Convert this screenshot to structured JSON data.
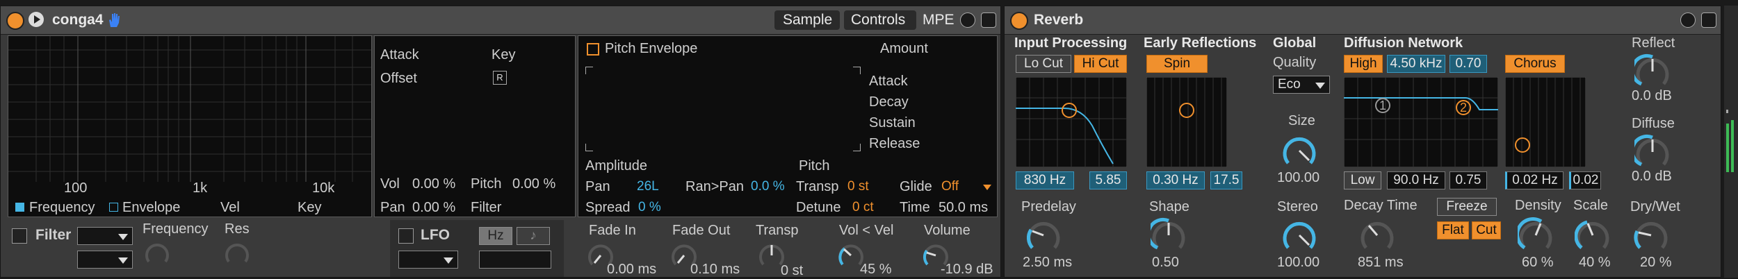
{
  "simpler": {
    "title": "conga4",
    "tabs": [
      "Sample",
      "Controls",
      "MPE"
    ],
    "filter_graph": {
      "freq_labels": [
        "100",
        "1k",
        "10k"
      ],
      "legend": [
        "Frequency",
        "Envelope",
        "Vel",
        "Key"
      ]
    },
    "mod": {
      "attack": "Attack",
      "key": "Key",
      "offset": "Offset",
      "retrig_icon": "R",
      "vol_label": "Vol",
      "vol_value": "0.00 %",
      "pitch_label": "Pitch",
      "pitch_value": "0.00 %",
      "pan_label": "Pan",
      "pan_value": "0.00 %",
      "filter_label": "Filter"
    },
    "pitch_env": {
      "title": "Pitch Envelope",
      "amount": "Amount",
      "params": [
        "Attack",
        "Decay",
        "Sustain",
        "Release"
      ]
    },
    "amp": {
      "amplitude": "Amplitude",
      "pitch": "Pitch",
      "pan_label": "Pan",
      "pan_value": "26L",
      "ranpan_label": "Ran>Pan",
      "ranpan_value": "0.0 %",
      "transp_label": "Transp",
      "transp_value": "0 st",
      "glide_label": "Glide",
      "glide_value": "Off",
      "spread_label": "Spread",
      "spread_value": "0 %",
      "detune_label": "Detune",
      "detune_value": "0 ct",
      "time_label": "Time",
      "time_value": "50.0 ms"
    },
    "filter": {
      "label": "Filter",
      "frequency": "Frequency",
      "res": "Res"
    },
    "lfo": {
      "label": "LFO",
      "hz": "Hz",
      "note_icon": "♪"
    },
    "bottom_knobs": [
      {
        "label": "Fade In",
        "value": "0.00 ms"
      },
      {
        "label": "Fade Out",
        "value": "0.10 ms"
      },
      {
        "label": "Transp",
        "value": "0 st"
      },
      {
        "label": "Vol < Vel",
        "value": "45 %"
      },
      {
        "label": "Volume",
        "value": "-10.9 dB"
      }
    ]
  },
  "reverb": {
    "title": "Reverb",
    "input": {
      "title": "Input Processing",
      "locut": "Lo Cut",
      "hicut": "Hi Cut",
      "freq": "830 Hz",
      "q": "5.85"
    },
    "early": {
      "title": "Early Reflections",
      "spin": "Spin",
      "rate": "0.30 Hz",
      "amount": "17.5"
    },
    "global": {
      "title": "Global",
      "quality": "Quality",
      "quality_value": "Eco",
      "size_label": "Size",
      "size_value": "100.00"
    },
    "diffusion": {
      "title": "Diffusion Network",
      "high": "High",
      "high_freq": "4.50 kHz",
      "high_val": "0.70",
      "chorus": "Chorus",
      "low": "Low",
      "low_freq": "90.0 Hz",
      "low_val": "0.75",
      "chorus_rate": "0.02 Hz",
      "chorus_amt": "0.02",
      "point1": "1",
      "point2": "2"
    },
    "reflect": {
      "label": "Reflect",
      "value": "0.0 dB"
    },
    "diffuse": {
      "label": "Diffuse",
      "value": "0.0 dB"
    },
    "predelay": {
      "label": "Predelay",
      "value": "2.50 ms"
    },
    "shape": {
      "label": "Shape",
      "value": "0.50"
    },
    "stereo": {
      "label": "Stereo",
      "value": "100.00"
    },
    "decay": {
      "label": "Decay Time",
      "value": "851 ms"
    },
    "freeze": "Freeze",
    "flat": "Flat",
    "cut": "Cut",
    "density": {
      "label": "Density",
      "value": "60 %"
    },
    "scale": {
      "label": "Scale",
      "value": "40 %"
    },
    "drywet": {
      "label": "Dry/Wet",
      "value": "20 %"
    }
  },
  "colors": {
    "accent": "#f0902d",
    "blue": "#45b6e5",
    "panel": "#3a3a3a"
  }
}
